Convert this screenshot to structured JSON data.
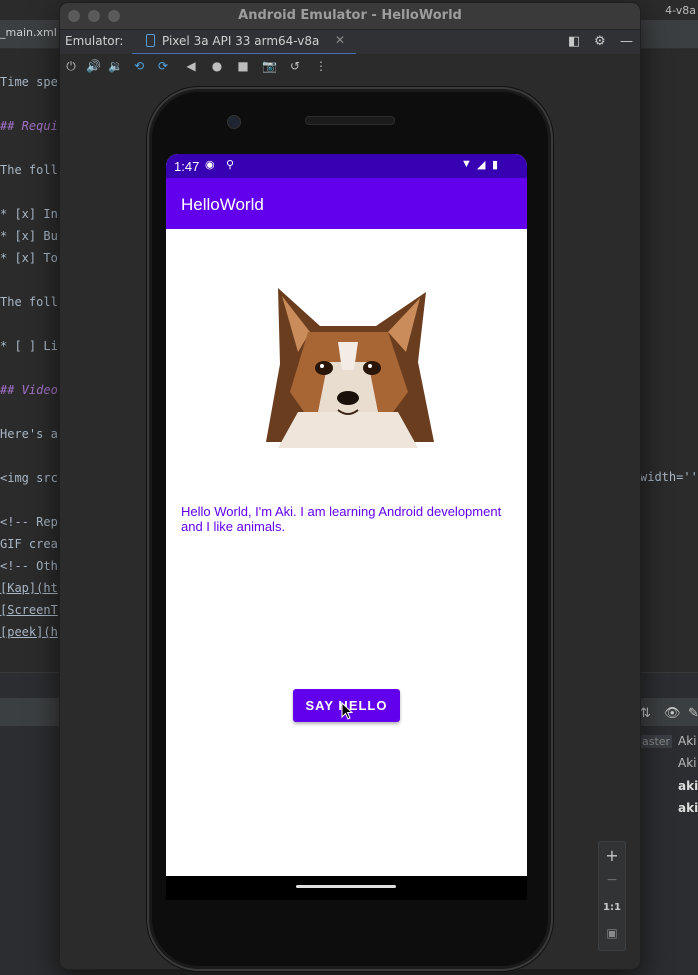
{
  "ide": {
    "file_tab": "_main.xml",
    "right_tab": "4-v8a",
    "code_lines": [
      {
        "text": "Time spe",
        "style": "normal"
      },
      {
        "text": "## Requi",
        "style": "heading"
      },
      {
        "text": "The foll",
        "style": "normal"
      },
      {
        "text": "* [x] In",
        "style": "normal"
      },
      {
        "text": "* [x] Bu",
        "style": "normal"
      },
      {
        "text": "* [x] To",
        "style": "normal"
      },
      {
        "text": "The foll",
        "style": "normal"
      },
      {
        "text": "* [ ] Li",
        "style": "normal"
      },
      {
        "text": "## Video",
        "style": "heading"
      },
      {
        "text": "Here's a",
        "style": "normal"
      },
      {
        "text": "<img src",
        "style": "normal"
      },
      {
        "text": "<!-- Rep",
        "style": "normal"
      },
      {
        "text": "GIF crea",
        "style": "normal"
      },
      {
        "text": "<!-- Oth",
        "style": "normal"
      },
      {
        "text": "[Kap](ht",
        "style": "link"
      },
      {
        "text": "[ScreenT",
        "style": "link"
      },
      {
        "text": "[peek](h",
        "style": "link"
      }
    ],
    "right_code": "width=''",
    "vcs_branch": "aster",
    "vcs_authors": [
      {
        "text": "Aki",
        "bold": false
      },
      {
        "text": "Aki",
        "bold": false
      },
      {
        "text": "aki",
        "bold": true
      },
      {
        "text": "aki",
        "bold": true
      }
    ]
  },
  "emulator": {
    "window_title": "Android Emulator - HelloWorld",
    "label": "Emulator:",
    "device_tab": "Pixel 3a API 33 arm64-v8a",
    "close_glyph": "✕",
    "zoom_in": "+",
    "zoom_out": "−",
    "zoom_actual": "1:1"
  },
  "phone": {
    "status_time": "1:47",
    "app_title": "HelloWorld",
    "hello_text": "Hello World, I'm Aki. I am learning Android development and I like animals.",
    "button_label": "SAY HELLO"
  },
  "colors": {
    "primary": "#6200ee",
    "primary_dark": "#3700b3"
  }
}
